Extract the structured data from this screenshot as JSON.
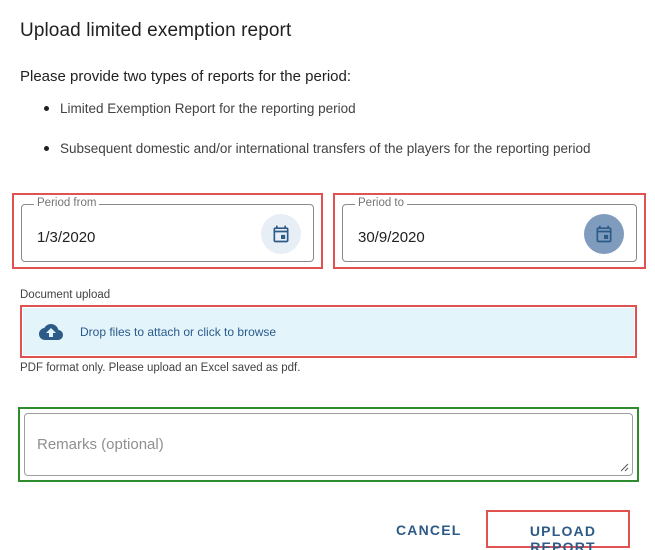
{
  "dialog": {
    "title": "Upload limited exemption report",
    "intro": "Please provide two types of reports for the period:",
    "bullets": [
      "Limited Exemption Report for the reporting period",
      "Subsequent domestic and/or international transfers of the players for the reporting period"
    ]
  },
  "period_from": {
    "label": "Period from",
    "value": "1/3/2020",
    "icon": "calendar-icon"
  },
  "period_to": {
    "label": "Period to",
    "value": "30/9/2020",
    "icon": "calendar-icon"
  },
  "document_upload": {
    "label": "Document upload",
    "dropzone_text": "Drop files to attach or click to browse",
    "icon": "cloud-upload-icon",
    "hint": "PDF format only. Please upload an Excel saved as pdf."
  },
  "remarks": {
    "placeholder": "Remarks (optional)"
  },
  "actions": {
    "cancel": "CANCEL",
    "upload": "UPLOAD REPORT"
  },
  "colors": {
    "accent": "#2d5b87",
    "highlight_red": "#e05252",
    "highlight_green": "#2e8b2e",
    "dropzone_bg": "#e3f4fb"
  }
}
